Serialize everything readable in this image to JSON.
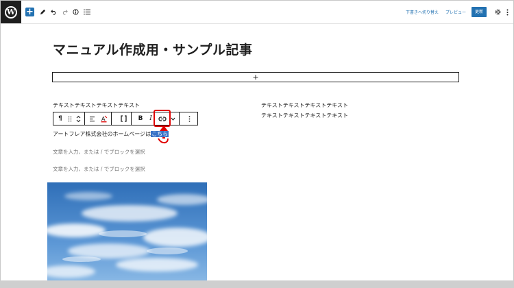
{
  "topbar": {
    "add_icon": "plus-icon",
    "tools": [
      "pencil-icon",
      "undo-icon",
      "redo-icon",
      "info-icon",
      "list-view-icon"
    ],
    "save_draft": "下書きへ切り替え",
    "preview": "プレビュー",
    "publish": "更新",
    "settings_icon": "gear-icon",
    "more_icon": "more-vertical-icon"
  },
  "editor": {
    "title": "マニュアル作成用・サンプル記事",
    "inserter_symbol": "+",
    "left_column_text": "テキストテキストテキストテキスト",
    "right_column_line1": "テキストテキストテキストテキスト",
    "right_column_line2": "テキストテキストテキストテキスト",
    "paragraph_text": "アートフレア株式会社のホームページは",
    "paragraph_selected": "こちら",
    "placeholder1": "文章を入力、または / でブロックを選択",
    "placeholder2": "文章を入力、または / でブロックを選択"
  },
  "block_toolbar": {
    "paragraph_icon": "¶",
    "bold": "B",
    "italic": "I"
  },
  "annotation": {
    "highlight_color": "#e00000",
    "target": "link-icon"
  },
  "colors": {
    "accent": "#2271b1",
    "selection": "#3872c6"
  }
}
